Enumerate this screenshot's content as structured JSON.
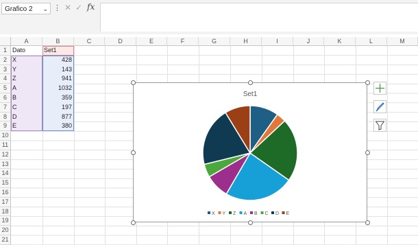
{
  "formula_bar": {
    "name_box": "Grafico 2",
    "fx_label": "fx",
    "cancel_glyph": "✕",
    "enter_glyph": "✓",
    "formula": ""
  },
  "columns": [
    "A",
    "B",
    "C",
    "D",
    "E",
    "F",
    "G",
    "H",
    "I",
    "J",
    "K",
    "L",
    "M"
  ],
  "rows": [
    "1",
    "2",
    "3",
    "4",
    "5",
    "6",
    "7",
    "8",
    "9",
    "10",
    "11",
    "12",
    "13",
    "14",
    "15",
    "16",
    "17",
    "18",
    "19",
    "20",
    "21"
  ],
  "table": {
    "header": [
      "Dato",
      "Set1"
    ],
    "rows": [
      {
        "label": "X",
        "value": "428"
      },
      {
        "label": "Y",
        "value": "143"
      },
      {
        "label": "Z",
        "value": "941"
      },
      {
        "label": "A",
        "value": "1032"
      },
      {
        "label": "B",
        "value": "359"
      },
      {
        "label": "C",
        "value": "197"
      },
      {
        "label": "D",
        "value": "877"
      },
      {
        "label": "E",
        "value": "380"
      }
    ]
  },
  "colors": {
    "X": "#1f5f86",
    "Y": "#e2773a",
    "Z": "#1e6b27",
    "A": "#17a0d8",
    "B": "#9c2f8c",
    "C": "#4aa83d",
    "D": "#0f3a52",
    "E": "#9b3f16"
  },
  "chart_data": {
    "type": "pie",
    "title": "Set1",
    "categories": [
      "X",
      "Y",
      "Z",
      "A",
      "B",
      "C",
      "D",
      "E"
    ],
    "values": [
      428,
      143,
      941,
      1032,
      359,
      197,
      877,
      380
    ],
    "legend_position": "bottom"
  },
  "side_buttons": [
    {
      "name": "chart-elements-button",
      "icon": "plus-icon"
    },
    {
      "name": "chart-styles-button",
      "icon": "brush-icon"
    },
    {
      "name": "chart-filters-button",
      "icon": "filter-icon"
    }
  ]
}
